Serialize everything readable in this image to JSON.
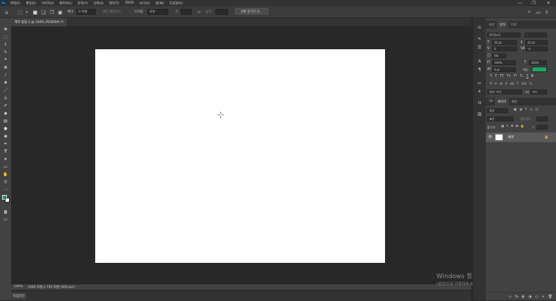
{
  "menubar": {
    "logo": "Ps",
    "items": [
      "파일(F)",
      "편집(E)",
      "이미지(I)",
      "레이어(L)",
      "문자(Y)",
      "선택(S)",
      "필터(T)",
      "3D(D)",
      "보기(V)",
      "창(W)",
      "도움말(H)"
    ],
    "window_controls": [
      "—",
      "❐",
      "✕"
    ]
  },
  "options_bar": {
    "feather_label": "페더:",
    "feather_value": "0 픽셀",
    "antialias_label": "앤티 앨리어스",
    "style_label": "스타일:",
    "style_value": "표준",
    "width_label": "폭:",
    "height_label": "높이:",
    "select_mask_button": "선택 및 마스크..."
  },
  "document": {
    "tab_title": "제목 없음-1 @ 100% (RGB/8#) *",
    "close": "×"
  },
  "statusbar": {
    "zoom": "100%",
    "doc_info": "1000 픽셀 x 739 픽셀 (300 ppi)",
    "arrow": "›"
  },
  "timeline": {
    "label": "타임라인"
  },
  "watermark": {
    "line1": "Windows 정품 인증",
    "line2": "[설정]으로 이동하여 Windows를 정품 인증합니다."
  },
  "character_panel": {
    "tabs": [
      "속성",
      "문자",
      "단락"
    ],
    "active_tab": "문자",
    "font_family": "HY견고딕",
    "font_style": "-",
    "font_size": "30 pt",
    "leading": "43 pt",
    "kerning": "0",
    "tracking": "-4",
    "tsume": "0%",
    "vertical_scale": "100%",
    "horizontal_scale": "100%",
    "baseline_shift": "0 pt",
    "color_label": "색상:",
    "color_hex": "#1ea564",
    "type_buttons": [
      "T",
      "T",
      "TT",
      "Tт",
      "T¹",
      "T₁",
      "T",
      "T"
    ],
    "opentype_buttons": [
      "fi",
      "σ",
      "st",
      "A",
      "ad",
      "T",
      "1st",
      "½"
    ],
    "language": "영어: 미국",
    "aa_label": "aa",
    "aa_value": "하드"
  },
  "layers_panel": {
    "tabs": [
      "3D",
      "레이어",
      "채널"
    ],
    "active_tab": "레이어",
    "filter_label": "종류",
    "blend_mode": "표준",
    "opacity_label": "불투명도:",
    "lock_label": "잠그기:",
    "fill_label": "칠:",
    "layer_name": "배경",
    "bottom_icons": [
      "∞",
      "fx",
      "◐",
      "◑",
      "▭",
      "+",
      "🗑"
    ]
  },
  "colors": {
    "foreground": "#1ea564",
    "background": "#ffffff"
  }
}
